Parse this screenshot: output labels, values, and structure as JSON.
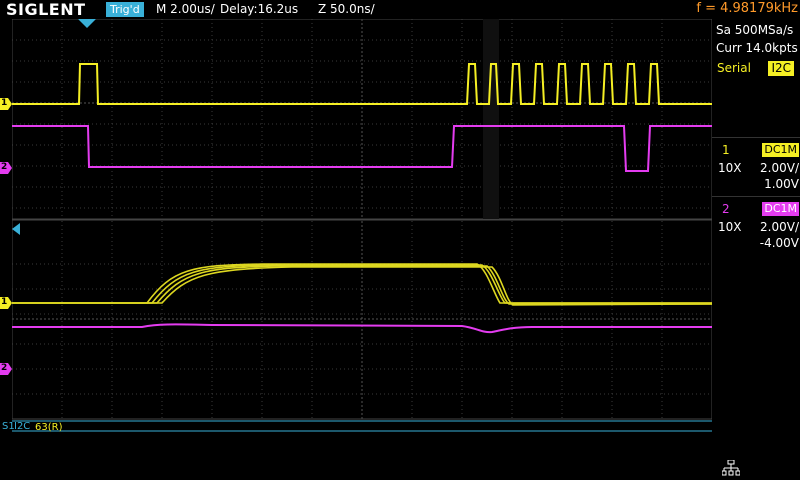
{
  "topbar": {
    "brand": "SIGLENT",
    "trig_status": "Trig'd",
    "timebase": "M 2.00us/",
    "delay": "Delay:16.2us",
    "zoom": "Z 50.0ns/",
    "frequency": "f = 4.98179kHz"
  },
  "panel": {
    "sample_rate": "Sa 500MSa/s",
    "memory": "Curr 14.0kpts",
    "serial_label": "Serial",
    "serial_protocol": "I2C",
    "ch1": {
      "number": "1",
      "coupling": "DC1M",
      "probe": "10X",
      "vdiv": "2.00V/",
      "offset": "1.00V"
    },
    "ch2": {
      "number": "2",
      "coupling": "DC1M",
      "probe": "10X",
      "vdiv": "2.00V/",
      "offset": "-4.00V"
    }
  },
  "decode": {
    "bus_label": "I2C",
    "value": "63(R)"
  },
  "markers": {
    "ch1": "1",
    "ch2": "2",
    "s1": "S1"
  },
  "colors": {
    "ch1": "#f5ef24",
    "ch2": "#e43cf0",
    "trigger": "#39b0d8",
    "frequency": "#ff9a2a"
  }
}
